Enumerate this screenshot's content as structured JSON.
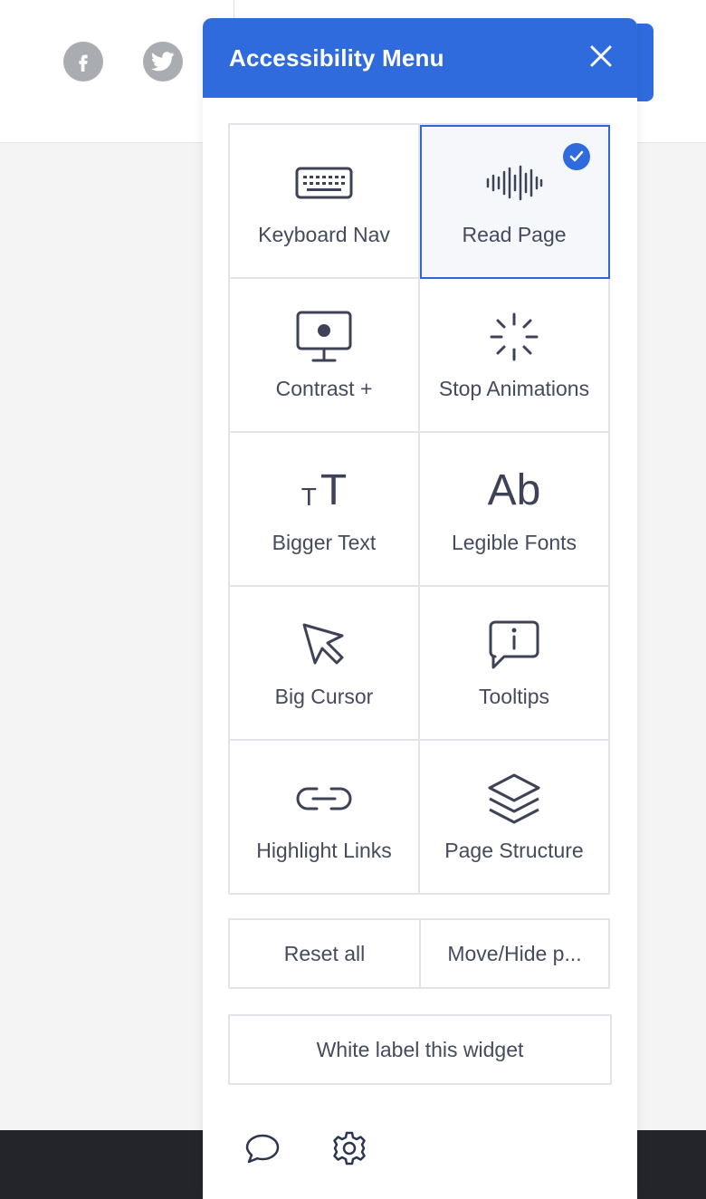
{
  "panel": {
    "title": "Accessibility Menu",
    "accent_color": "#2f6bdd",
    "tiles": [
      {
        "label": "Keyboard Nav",
        "icon": "keyboard-icon",
        "active": false
      },
      {
        "label": "Read Page",
        "icon": "sound-wave-icon",
        "active": true
      },
      {
        "label": "Contrast +",
        "icon": "monitor-contrast-icon",
        "active": false
      },
      {
        "label": "Stop Animations",
        "icon": "spinner-icon",
        "active": false
      },
      {
        "label": "Bigger Text",
        "icon": "text-size-icon",
        "icon_text": "TT",
        "active": false
      },
      {
        "label": "Legible Fonts",
        "icon": "font-icon",
        "icon_text": "Ab",
        "active": false
      },
      {
        "label": "Big Cursor",
        "icon": "cursor-icon",
        "active": false
      },
      {
        "label": "Tooltips",
        "icon": "tooltip-icon",
        "active": false
      },
      {
        "label": "Highlight Links",
        "icon": "link-icon",
        "active": false
      },
      {
        "label": "Page Structure",
        "icon": "layers-icon",
        "active": false
      }
    ],
    "actions": {
      "reset_label": "Reset all",
      "move_label": "Move/Hide p..."
    },
    "white_label": "White label this widget",
    "footer_icons": [
      "chat-icon",
      "gear-icon"
    ]
  },
  "background": {
    "social_icons": [
      "facebook-icon",
      "twitter-icon"
    ]
  }
}
